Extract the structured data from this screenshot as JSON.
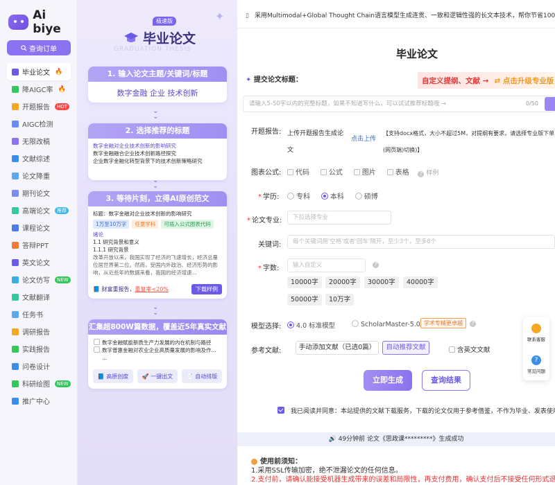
{
  "brand": {
    "name": "Ai biye"
  },
  "sidebar": {
    "order_button": "查询订单",
    "items": [
      {
        "label": "毕业论文",
        "color": "#6b5ae8",
        "extra": "fire",
        "badge": ""
      },
      {
        "label": "降AIGC率",
        "color": "#34c759",
        "extra": "fire",
        "badge": ""
      },
      {
        "label": "开题报告",
        "color": "#f5a623",
        "extra": "",
        "badge": "HOT"
      },
      {
        "label": "AIGC检测",
        "color": "#6b8cf0",
        "extra": "",
        "badge": ""
      },
      {
        "label": "无限改稿",
        "color": "#8b72f0",
        "extra": "",
        "badge": ""
      },
      {
        "label": "文献综述",
        "color": "#3a8ee8",
        "extra": "",
        "badge": ""
      },
      {
        "label": "论文降重",
        "color": "#5aa8f0",
        "extra": "",
        "badge": ""
      },
      {
        "label": "期刊论文",
        "color": "#7b8cf0",
        "extra": "",
        "badge": ""
      },
      {
        "label": "高端论文",
        "color": "#34c7a0",
        "extra": "",
        "badge": "推荐"
      },
      {
        "label": "课程论文",
        "color": "#4a7de8",
        "extra": "",
        "badge": ""
      },
      {
        "label": "答辩PPT",
        "color": "#f07a3a",
        "extra": "",
        "badge": ""
      },
      {
        "label": "英文论文",
        "color": "#6b5ae8",
        "extra": "",
        "badge": ""
      },
      {
        "label": "论文仿写",
        "color": "#3ab0e0",
        "extra": "",
        "badge": "NEW"
      },
      {
        "label": "文献翻译",
        "color": "#34c7a0",
        "extra": "",
        "badge": ""
      },
      {
        "label": "任务书",
        "color": "#5aa8f0",
        "extra": "",
        "badge": ""
      },
      {
        "label": "调研报告",
        "color": "#f5a623",
        "extra": "",
        "badge": ""
      },
      {
        "label": "实践报告",
        "color": "#34c759",
        "extra": "",
        "badge": ""
      },
      {
        "label": "问卷设计",
        "color": "#3a8ee8",
        "extra": "",
        "badge": ""
      },
      {
        "label": "科研绘图",
        "color": "#34c759",
        "extra": "",
        "badge": "NEW"
      },
      {
        "label": "推广中心",
        "color": "#3a8ee8",
        "extra": "",
        "badge": ""
      }
    ]
  },
  "hero": {
    "tag": "极速版",
    "title": "毕业论文",
    "subtitle": "GRADUATION THESIS",
    "step1": {
      "title": "1. 输入论文主题/关键词/标题",
      "keywords": "数字金融 企业 技术创新"
    },
    "step2": {
      "title": "2. 选择推荐的标题",
      "options": [
        "数字金融对企业技术创新的影响研究",
        "数字金融融合企业技术创新路径探究",
        "企业数字金融化转型背景下的技术创新策略研究"
      ]
    },
    "step3": {
      "title": "3. 等待片刻，立得AI原创范文",
      "heading": "标题：数字金融对企业技术创新的影响研究",
      "tags": [
        "1万至10万字",
        "任意学科",
        "可插入公式图表代码"
      ],
      "outline": [
        "绪论",
        "1.1 研究背景和意义",
        "1.1.1 研究背景",
        "改革开放以来，我国实现了经济的飞速增长，经济总量位居世界第二位。然而，受国内外政治、经济形势的影响，从近些年的数据来看，我国的经济增速..."
      ],
      "foot_text": "财富重报告，",
      "foot_rate": "重复率<20%",
      "download": "下载样例"
    },
    "step4": {
      "title": "汇集超800W篇数据，覆盖近5年真实文献",
      "refs": [
        "数字金融赋能新质生产力发展的内在机制与路径",
        "数字普惠金融对农业企业高质量发展的影响及作...",
        "..."
      ],
      "buttons": [
        "高原创度",
        "一键出文",
        "自动排版"
      ]
    }
  },
  "main": {
    "notice": "采用Multimodal+Global Thought Chain语言模型生成连贯、一致和逻辑性强的长文本技术，帮你节省100小时",
    "title": "毕业论文",
    "form": {
      "title_label": "提交论文标题：",
      "promo_left": "自定义提纲、文献 →",
      "promo_right": "⇄ 点击升级专业版",
      "title_placeholder": "请输入5-50字以内的完整标题，如果不知道写什么，可以试试推荐标题哦 →",
      "counter": "0/50",
      "report_label": "开题报告:",
      "report_upload_text": "上传开题报告生成论文",
      "report_upload_link": "点击上传",
      "report_note": "【支持docx格式，大小不超过5M，对提纲有要求，请选择专业版下单(网页端)切换)】",
      "chart_label": "图表公式:",
      "chart_options": [
        "代码",
        "公式",
        "图片",
        "表格"
      ],
      "chart_example": "样例",
      "degree_label": "学历:",
      "degree_options": [
        "专科",
        "本科",
        "硕博"
      ],
      "degree_selected": "本科",
      "major_label": "论文专业:",
      "major_placeholder": "下拉选择专业",
      "kw_label": "关键词:",
      "kw_placeholder": "每个关键词用'空格'或者'回车'隔开，至少3个，至多8个",
      "words_label": "字数:",
      "words_placeholder": "输入自定义",
      "word_chips": [
        "10000字",
        "20000字",
        "30000字",
        "40000字",
        "50000字",
        "10万字"
      ],
      "model_label": "模型选择:",
      "model_options": [
        "4.0 标准模型",
        "ScholarMaster-5.0"
      ],
      "model_upgrade": "学术专精更卓越",
      "ref_label": "参考文献:",
      "ref_manual": "手动添加文献（已选0篇）",
      "ref_auto": "自动推荐文献",
      "ref_english": "含英文文献",
      "generate": "立即生成",
      "query": "查询结果",
      "agree": "我已阅读并同意：本站提供的文献下载服务，下载的论文仅用于参考借鉴，不作为毕业、发表使用"
    },
    "success": "49分钟前 论文《思政课*********》生成成功",
    "must": {
      "title": "使用前须知：",
      "items": [
        "1.采用SSL传输加密，绝不泄漏论文的任何信息。",
        "2.支付前，请确认能接受机器生成带来的误差和局限性，再支付费用，确认支付后不接受任何形式退款。"
      ]
    },
    "float": {
      "service": "联系客服",
      "faq": "常见问题"
    }
  }
}
